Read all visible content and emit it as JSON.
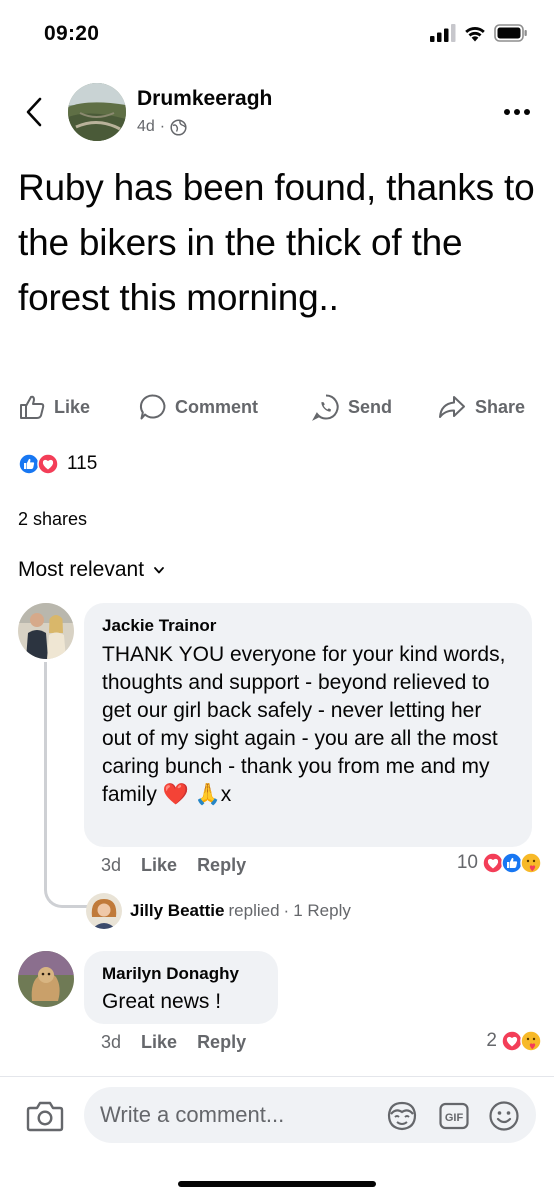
{
  "status_bar": {
    "time": "09:20",
    "icons": [
      "signal-icon",
      "wifi-icon",
      "battery-icon"
    ]
  },
  "header": {
    "group_name": "Drumkeeragh",
    "age": "4d",
    "separator": "·",
    "audience_icon": "globe-icon"
  },
  "post": {
    "text": "Ruby has been found, thanks to the bikers in the thick of the forest this morning.."
  },
  "actions": {
    "like": "Like",
    "comment": "Comment",
    "send": "Send",
    "share": "Share"
  },
  "stats": {
    "reactions": "115",
    "reaction_types": [
      "like",
      "love"
    ],
    "shares": "2 shares"
  },
  "sort": {
    "label": "Most relevant"
  },
  "comments": [
    {
      "author": "Jackie Trainor",
      "text": "THANK YOU everyone for your kind words, thoughts and support - beyond relieved to get our girl back safely - never letting her out of my sight again - you are all the most caring bunch - thank you from me and my family ❤️ 🙏x",
      "time": "3d",
      "like": "Like",
      "reply": "Reply",
      "reaction_count": "10",
      "reaction_types": [
        "love",
        "like",
        "care"
      ],
      "replies": {
        "author": "Jilly Beattie",
        "verb": "replied",
        "separator": "·",
        "count": "1 Reply"
      }
    },
    {
      "author": "Marilyn Donaghy",
      "text": "Great news !",
      "time": "3d",
      "like": "Like",
      "reply": "Reply",
      "reaction_count": "2",
      "reaction_types": [
        "love",
        "care"
      ]
    }
  ],
  "composer": {
    "placeholder": "Write a comment...",
    "icons": [
      "camera-icon",
      "avatar-sticker-icon",
      "gif-icon",
      "emoji-icon"
    ]
  },
  "colors": {
    "primary_text": "#050505",
    "secondary_text": "#65676b",
    "bubble": "#f0f2f5",
    "like_blue": "#1877f2",
    "love_red": "#f33e58",
    "care_yellow": "#f7b928"
  }
}
